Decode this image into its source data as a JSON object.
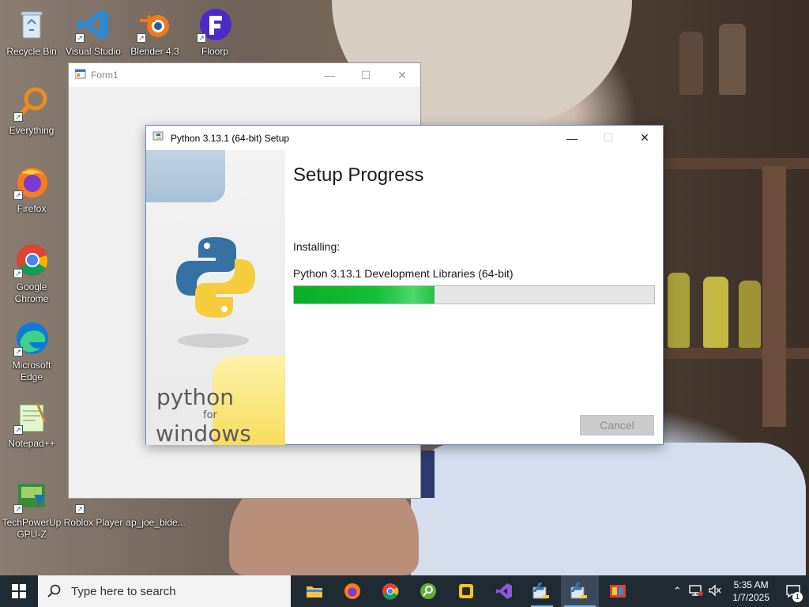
{
  "desktop": {
    "icons": [
      {
        "label": "Recycle Bin",
        "icon": "recycle-bin-icon"
      },
      {
        "label": "Visual Studio Code",
        "icon": "vscode-icon"
      },
      {
        "label": "Blender 4.3",
        "icon": "blender-icon"
      },
      {
        "label": "Floorp",
        "icon": "floorp-icon"
      },
      {
        "label": "Everything",
        "icon": "everything-icon"
      },
      {
        "label": "Firefox",
        "icon": "firefox-icon"
      },
      {
        "label": "Google Chrome",
        "icon": "chrome-icon"
      },
      {
        "label": "Microsoft Edge",
        "icon": "edge-icon"
      },
      {
        "label": "Notepad++",
        "icon": "notepadpp-icon"
      },
      {
        "label": "TechPowerUp GPU-Z",
        "icon": "gpuz-icon"
      },
      {
        "label": "Roblox Player",
        "icon": "roblox-icon"
      },
      {
        "label": "ap_joe_bide...",
        "icon": "image-file-icon"
      }
    ]
  },
  "form1": {
    "title": "Form1"
  },
  "setup": {
    "title": "Python 3.13.1 (64-bit) Setup",
    "heading": "Setup Progress",
    "installing_label": "Installing:",
    "current_item": "Python 3.13.1 Development Libraries (64-bit)",
    "progress_fraction": 0.39,
    "cancel_label": "Cancel",
    "sidebar": {
      "line1": "python",
      "line2": "for",
      "line3": "windows"
    }
  },
  "taskbar": {
    "search_placeholder": "Type here to search",
    "apps": [
      "file-explorer-icon",
      "firefox-icon",
      "chrome-icon",
      "everything-icon",
      "sticky-app-icon",
      "visual-studio-icon",
      "python-setup-icon",
      "python-setup-active-icon",
      "photo-app-icon"
    ],
    "time": "5:35 AM",
    "date": "1/7/2025",
    "notification_count": "1"
  }
}
